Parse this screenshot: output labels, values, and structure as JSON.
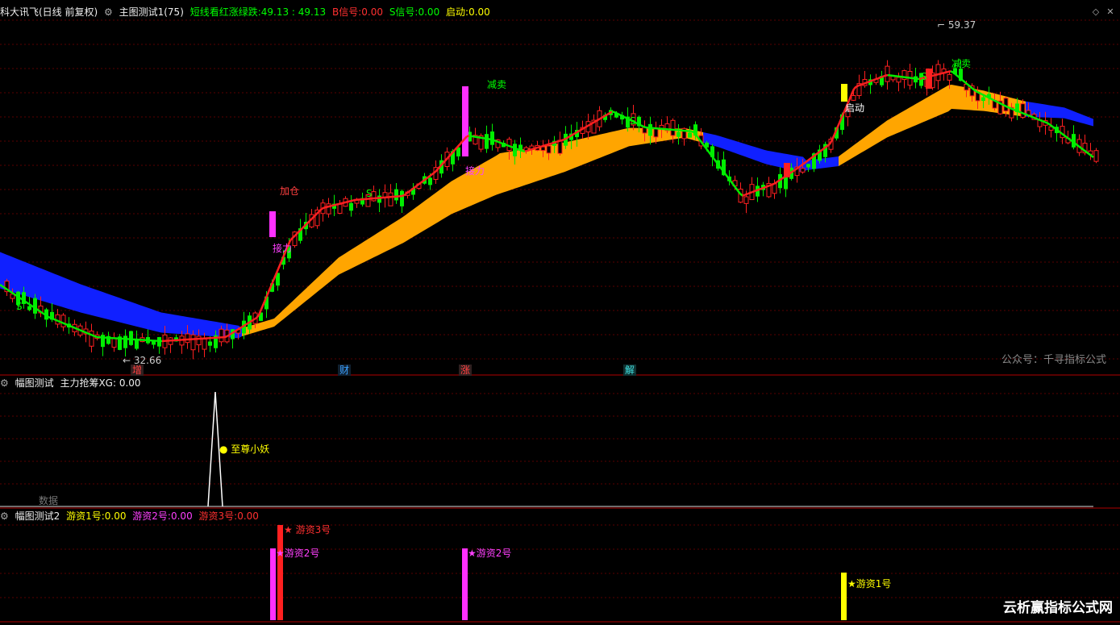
{
  "main": {
    "stock_title": "科大讯飞(日线 前复权)",
    "indicator_name": "主图测试1(75)",
    "indicators": [
      {
        "label": "短线看红涨绿跌:",
        "value": "49.13 : 49.13",
        "color": "#00ff00"
      },
      {
        "label": "B信号:",
        "value": "0.00",
        "color": "#ff3030"
      },
      {
        "label": "S信号:",
        "value": "0.00",
        "color": "#00ff00"
      },
      {
        "label": "启动:",
        "value": "0.00",
        "color": "#ffff00"
      }
    ],
    "price_high": "59.37",
    "price_low": "32.66",
    "watermark": "公众号：千寻指标公式",
    "labels": {
      "jiacang": "加仓",
      "jieli_1": "接力",
      "jieli_2": "接力",
      "jianmai_1": "减卖",
      "jianmai_2": "减卖",
      "qidong": "启动",
      "s": "S",
      "b": "B"
    },
    "events": [
      {
        "text": "增",
        "color": "#ff4040"
      },
      {
        "text": "财",
        "color": "#3aa0ff"
      },
      {
        "text": "涨",
        "color": "#ff4040"
      },
      {
        "text": "解",
        "color": "#40e0e0"
      }
    ],
    "colors": {
      "up": "#ff2020",
      "down": "#00ee00",
      "band_orange": "#ffa500",
      "band_blue": "#1020ff"
    }
  },
  "sub1": {
    "title": "幅图测试",
    "indicator": "主力抢筹XG: 0.00",
    "peak_label": "至尊小妖",
    "ghost_text": "数据"
  },
  "sub2": {
    "title": "幅图测试2",
    "indicators": [
      {
        "label": "游资1号:",
        "value": "0.00",
        "color": "#ffff00"
      },
      {
        "label": "游资2号:",
        "value": "0.00",
        "color": "#ff40ff"
      },
      {
        "label": "游资3号:",
        "value": "0.00",
        "color": "#ff3030"
      }
    ],
    "bar_labels": {
      "yz3": "游资3号",
      "yz2_a": "游资2号",
      "yz2_b": "游资2号",
      "yz1": "游资1号"
    }
  },
  "site_watermark": "云析赢指标公式网"
}
